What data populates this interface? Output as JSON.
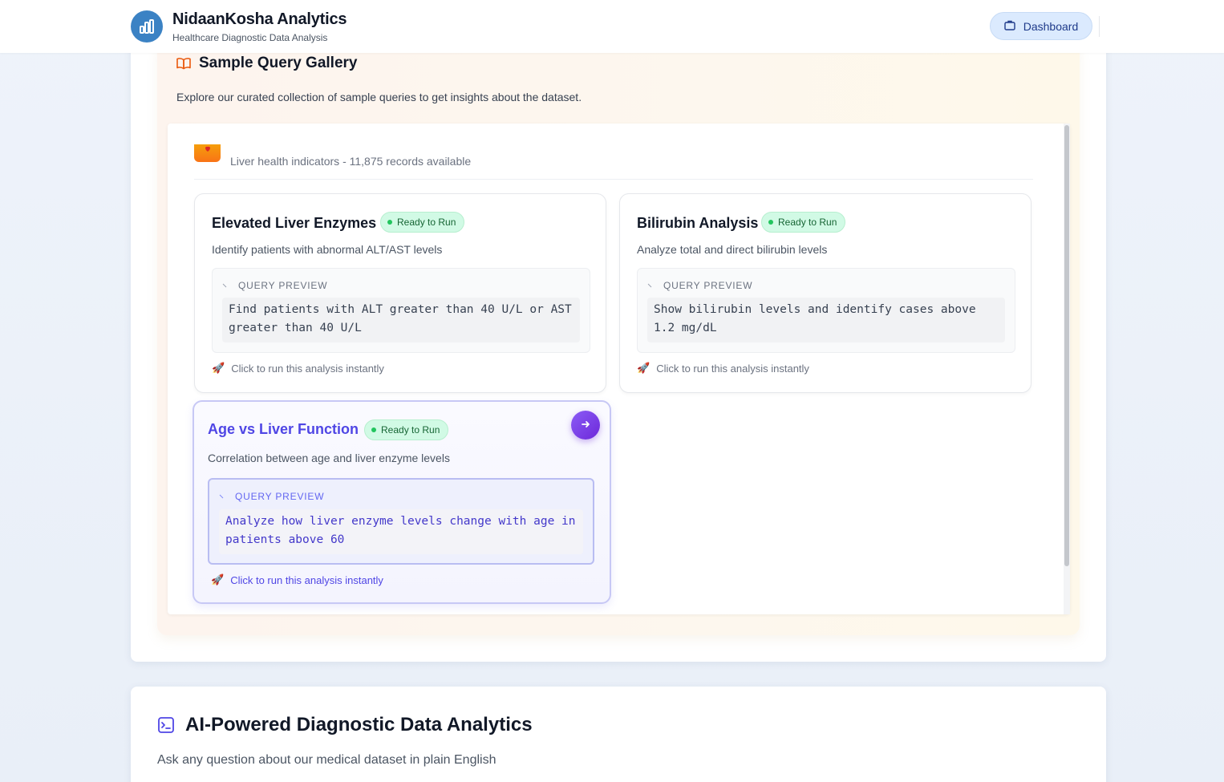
{
  "header": {
    "title": "NidaanKosha Analytics",
    "subtitle": "Healthcare Diagnostic Data Analysis",
    "dashboard_label": "Dashboard",
    "logo_icon": "bar-chart-icon"
  },
  "gallery": {
    "title": "Sample Query Gallery",
    "description": "Explore our curated collection of sample queries to get insights about the dataset.",
    "dataset_subtitle": "Liver health indicators - 11,875 records available",
    "cards": [
      {
        "title": "Elevated Liver Enzymes",
        "badge": "Ready to Run",
        "description": "Identify patients with abnormal ALT/AST levels",
        "preview_label": "QUERY PREVIEW",
        "query": "Find patients with ALT greater than 40 U/L or AST greater than 40 U/L",
        "run_hint": "Click to run this analysis instantly"
      },
      {
        "title": "Bilirubin Analysis",
        "badge": "Ready to Run",
        "description": "Analyze total and direct bilirubin levels",
        "preview_label": "QUERY PREVIEW",
        "query": "Show bilirubin levels and identify cases above 1.2 mg/dL",
        "run_hint": "Click to run this analysis instantly"
      },
      {
        "title": "Age vs Liver Function",
        "badge": "Ready to Run",
        "description": "Correlation between age and liver enzyme levels",
        "preview_label": "QUERY PREVIEW",
        "query": "Analyze how liver enzyme levels change with age in patients above 60",
        "run_hint": "Click to run this analysis instantly"
      }
    ]
  },
  "ai_section": {
    "title": "AI-Powered Diagnostic Data Analytics",
    "subtitle": "Ask any question about our medical dataset in plain English"
  },
  "colors": {
    "accent": "#4f46e5",
    "brand": "#3b82c4",
    "badge_bg": "#d1fae5",
    "badge_text": "#166534"
  }
}
